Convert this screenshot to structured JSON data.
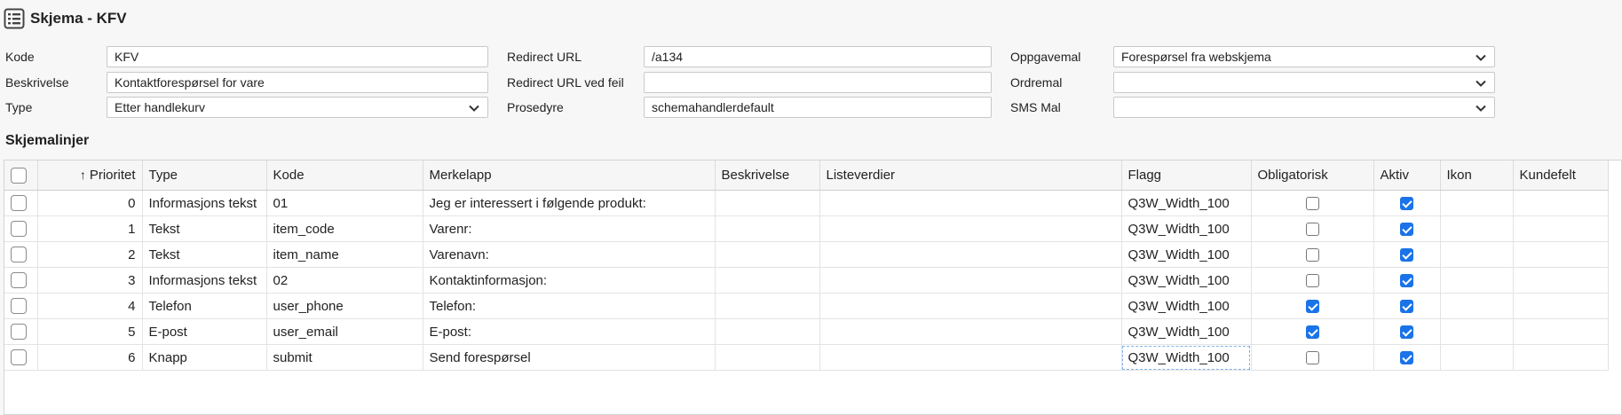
{
  "header": {
    "title": "Skjema - KFV",
    "icon": "list-icon"
  },
  "form": {
    "kode": {
      "label": "Kode",
      "value": "KFV"
    },
    "beskrivelse": {
      "label": "Beskrivelse",
      "value": "Kontaktforespørsel for vare"
    },
    "type": {
      "label": "Type",
      "value": "Etter handlekurv"
    },
    "redirect_url": {
      "label": "Redirect URL",
      "value": "/a134"
    },
    "redirect_url_feil": {
      "label": "Redirect URL ved feil",
      "value": ""
    },
    "prosedyre": {
      "label": "Prosedyre",
      "value": "schemahandlerdefault"
    },
    "oppgavemal": {
      "label": "Oppgavemal",
      "value": "Forespørsel fra webskjema"
    },
    "ordremal": {
      "label": "Ordremal",
      "value": ""
    },
    "sms_mal": {
      "label": "SMS Mal",
      "value": ""
    }
  },
  "section": {
    "title": "Skjemalinjer"
  },
  "grid": {
    "columns": {
      "prioritet": "Prioritet",
      "type": "Type",
      "kode": "Kode",
      "merkelapp": "Merkelapp",
      "beskrivelse": "Beskrivelse",
      "listeverdier": "Listeverdier",
      "flagg": "Flagg",
      "obligatorisk": "Obligatorisk",
      "aktiv": "Aktiv",
      "ikon": "Ikon",
      "kundefelt": "Kundefelt"
    },
    "sort_indicator": "↑",
    "rows": [
      {
        "prioritet": "0",
        "type": "Informasjons tekst",
        "kode": "01",
        "merkelapp": "Jeg er interessert i følgende produkt:",
        "beskrivelse": "",
        "listeverdier": "",
        "flagg": "Q3W_Width_100",
        "obligatorisk": false,
        "aktiv": true,
        "ikon": "",
        "kundefelt": ""
      },
      {
        "prioritet": "1",
        "type": "Tekst",
        "kode": "item_code",
        "merkelapp": "Varenr:",
        "beskrivelse": "",
        "listeverdier": "",
        "flagg": "Q3W_Width_100",
        "obligatorisk": false,
        "aktiv": true,
        "ikon": "",
        "kundefelt": ""
      },
      {
        "prioritet": "2",
        "type": "Tekst",
        "kode": "item_name",
        "merkelapp": "Varenavn:",
        "beskrivelse": "",
        "listeverdier": "",
        "flagg": "Q3W_Width_100",
        "obligatorisk": false,
        "aktiv": true,
        "ikon": "",
        "kundefelt": ""
      },
      {
        "prioritet": "3",
        "type": "Informasjons tekst",
        "kode": "02",
        "merkelapp": "Kontaktinformasjon:",
        "beskrivelse": "",
        "listeverdier": "",
        "flagg": "Q3W_Width_100",
        "obligatorisk": false,
        "aktiv": true,
        "ikon": "",
        "kundefelt": ""
      },
      {
        "prioritet": "4",
        "type": "Telefon",
        "kode": "user_phone",
        "merkelapp": "Telefon:",
        "beskrivelse": "",
        "listeverdier": "",
        "flagg": "Q3W_Width_100",
        "obligatorisk": true,
        "aktiv": true,
        "ikon": "",
        "kundefelt": ""
      },
      {
        "prioritet": "5",
        "type": "E-post",
        "kode": "user_email",
        "merkelapp": "E-post:",
        "beskrivelse": "",
        "listeverdier": "",
        "flagg": "Q3W_Width_100",
        "obligatorisk": true,
        "aktiv": true,
        "ikon": "",
        "kundefelt": ""
      },
      {
        "prioritet": "6",
        "type": "Knapp",
        "kode": "submit",
        "merkelapp": "Send forespørsel",
        "beskrivelse": "",
        "listeverdier": "",
        "flagg": "Q3W_Width_100",
        "obligatorisk": false,
        "aktiv": true,
        "ikon": "",
        "kundefelt": ""
      }
    ]
  },
  "colors": {
    "checkbox_checked": "#1a73e8",
    "header_bg": "#f5f6f5"
  }
}
